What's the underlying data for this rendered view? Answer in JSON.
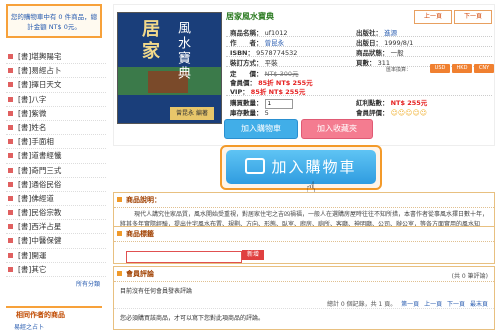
{
  "cart": {
    "line1": "您的購物車中有 0 件商品，總計金額 NT$ 0元。"
  },
  "categories": [
    "[書]堪輿陽宅",
    "[書]易經占卜",
    "[書]擇日天文",
    "[書]八字",
    "[書]紫微",
    "[書]姓名",
    "[書]手面相",
    "[書]道書經懺",
    "[書]奇門三式",
    "[書]通俗民俗",
    "[書]佛經道",
    "[書]民俗宗教",
    "[書]西洋占星",
    "[書]中醫保健",
    "[書]開運",
    "[書]其它"
  ],
  "more_categories": "所有分類",
  "related": {
    "heading": "相同作者的商品",
    "item": "易經之占卜"
  },
  "product": {
    "title": "居家風水寶典",
    "prev": "上一頁",
    "next": "下一頁",
    "cover_title": "居家",
    "cover_sub": "風水寶典",
    "cover_author": "曾昆永 編著",
    "fields": {
      "name_k": "商品名稱：",
      "name_v": "uf1012",
      "author_k": "作　　者：",
      "author_v": "曾昆永",
      "isbn_k": "ISBN：",
      "isbn_v": "9578774532",
      "binding_k": "裝訂方式：",
      "binding_v": "平裝",
      "publisher_k": "出版社：",
      "publisher_v": "進源",
      "date_k": "出版日：",
      "date_v": "1999/8/1",
      "status_k": "商品狀態：",
      "status_v": "一般",
      "pages_k": "頁數：",
      "pages_v": "311"
    },
    "list_price_k": "定　　價：",
    "list_price_v": "NT$ 300元",
    "member_price_k": "會員價：",
    "member_price_v": "85折 NT$ 255元",
    "vip_price_k": "VIP：",
    "vip_price_v": "85折 NT$ 255元",
    "currency_label": "匯率換算：",
    "currencies": [
      "USD",
      "HKD",
      "CNY"
    ],
    "qty_k": "購買數量：",
    "qty_v": "1",
    "stock_k": "庫存數量：",
    "stock_v": "5",
    "points_k": "紅利點數：",
    "points_v": "NT$ 255元",
    "rating_k": "會員評價：",
    "rating_stars": "☺☺☺☺☺",
    "add_cart": "加入購物車",
    "add_fav": "加入收藏夾"
  },
  "big_button": {
    "label": "加入購物車"
  },
  "description": {
    "heading": "商品說明：",
    "text": "現代人講究住家品質，風水開始受重視，對居家住宅之吉凶禍福，一般人在選購房屋時往往不知所措，本書作者從事風水擇日數十年，將其多年實際經驗，提出住宅風水布置、規劃、方向、形態、臥室、廚房、廁所、客廳、神明廳、公司、辦公室，等各方面實用的風水知識，讓讀者能夠了解並應用，使居家更安全舒適。"
  },
  "tags": {
    "heading": "商品標籤",
    "button": "新增"
  },
  "reviews": {
    "heading": "會員評論",
    "count": "(共 0 筆評論)",
    "empty": "目前沒有任何會員發表評論",
    "pager_total": "總計 0 個記錄，共 1 頁。",
    "first": "第一頁",
    "prev": "上一頁",
    "next": "下一頁",
    "last": "最末頁",
    "note": "您必須購買該商品，才可以寫下您對此項商品的評論。"
  }
}
